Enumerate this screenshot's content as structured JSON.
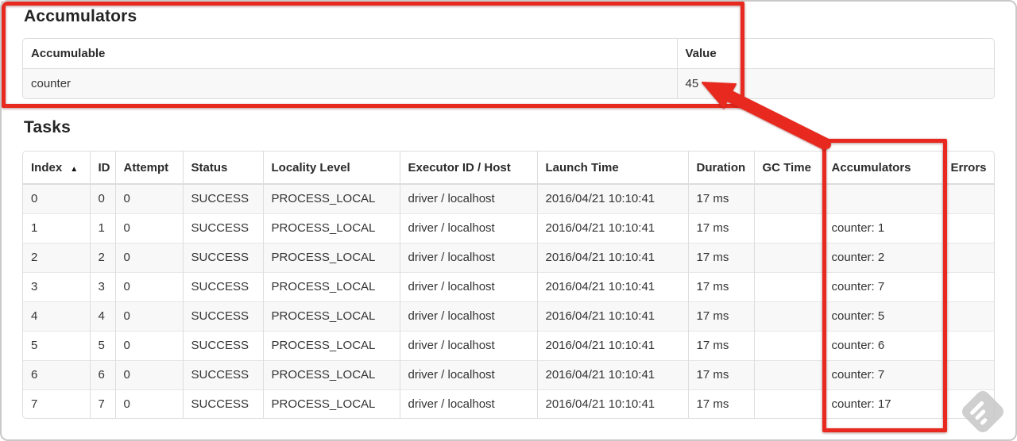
{
  "colors": {
    "annotation_red": "#e8291f",
    "row_stripe": "#f8f8f8",
    "table_border": "#dddddd",
    "watermark_gray": "#c7c7c7"
  },
  "accumulators": {
    "title": "Accumulators",
    "columns": [
      "Accumulable",
      "Value"
    ],
    "row": {
      "name": "counter",
      "value": "45"
    }
  },
  "tasks": {
    "title": "Tasks",
    "sort_icon": "▲",
    "columns": [
      "Index",
      "ID",
      "Attempt",
      "Status",
      "Locality Level",
      "Executor ID / Host",
      "Launch Time",
      "Duration",
      "GC Time",
      "Accumulators",
      "Errors"
    ],
    "rows": [
      {
        "index": "0",
        "id": "0",
        "attempt": "0",
        "status": "SUCCESS",
        "locality_level": "PROCESS_LOCAL",
        "executor_id_host": "driver / localhost",
        "launch_time": "2016/04/21 10:10:41",
        "duration": "17 ms",
        "gc_time": "",
        "accumulators": "",
        "errors": ""
      },
      {
        "index": "1",
        "id": "1",
        "attempt": "0",
        "status": "SUCCESS",
        "locality_level": "PROCESS_LOCAL",
        "executor_id_host": "driver / localhost",
        "launch_time": "2016/04/21 10:10:41",
        "duration": "17 ms",
        "gc_time": "",
        "accumulators": "counter: 1",
        "errors": ""
      },
      {
        "index": "2",
        "id": "2",
        "attempt": "0",
        "status": "SUCCESS",
        "locality_level": "PROCESS_LOCAL",
        "executor_id_host": "driver / localhost",
        "launch_time": "2016/04/21 10:10:41",
        "duration": "17 ms",
        "gc_time": "",
        "accumulators": "counter: 2",
        "errors": ""
      },
      {
        "index": "3",
        "id": "3",
        "attempt": "0",
        "status": "SUCCESS",
        "locality_level": "PROCESS_LOCAL",
        "executor_id_host": "driver / localhost",
        "launch_time": "2016/04/21 10:10:41",
        "duration": "17 ms",
        "gc_time": "",
        "accumulators": "counter: 7",
        "errors": ""
      },
      {
        "index": "4",
        "id": "4",
        "attempt": "0",
        "status": "SUCCESS",
        "locality_level": "PROCESS_LOCAL",
        "executor_id_host": "driver / localhost",
        "launch_time": "2016/04/21 10:10:41",
        "duration": "17 ms",
        "gc_time": "",
        "accumulators": "counter: 5",
        "errors": ""
      },
      {
        "index": "5",
        "id": "5",
        "attempt": "0",
        "status": "SUCCESS",
        "locality_level": "PROCESS_LOCAL",
        "executor_id_host": "driver / localhost",
        "launch_time": "2016/04/21 10:10:41",
        "duration": "17 ms",
        "gc_time": "",
        "accumulators": "counter: 6",
        "errors": ""
      },
      {
        "index": "6",
        "id": "6",
        "attempt": "0",
        "status": "SUCCESS",
        "locality_level": "PROCESS_LOCAL",
        "executor_id_host": "driver / localhost",
        "launch_time": "2016/04/21 10:10:41",
        "duration": "17 ms",
        "gc_time": "",
        "accumulators": "counter: 7",
        "errors": ""
      },
      {
        "index": "7",
        "id": "7",
        "attempt": "0",
        "status": "SUCCESS",
        "locality_level": "PROCESS_LOCAL",
        "executor_id_host": "driver / localhost",
        "launch_time": "2016/04/21 10:10:41",
        "duration": "17 ms",
        "gc_time": "",
        "accumulators": "counter: 17",
        "errors": ""
      }
    ]
  }
}
